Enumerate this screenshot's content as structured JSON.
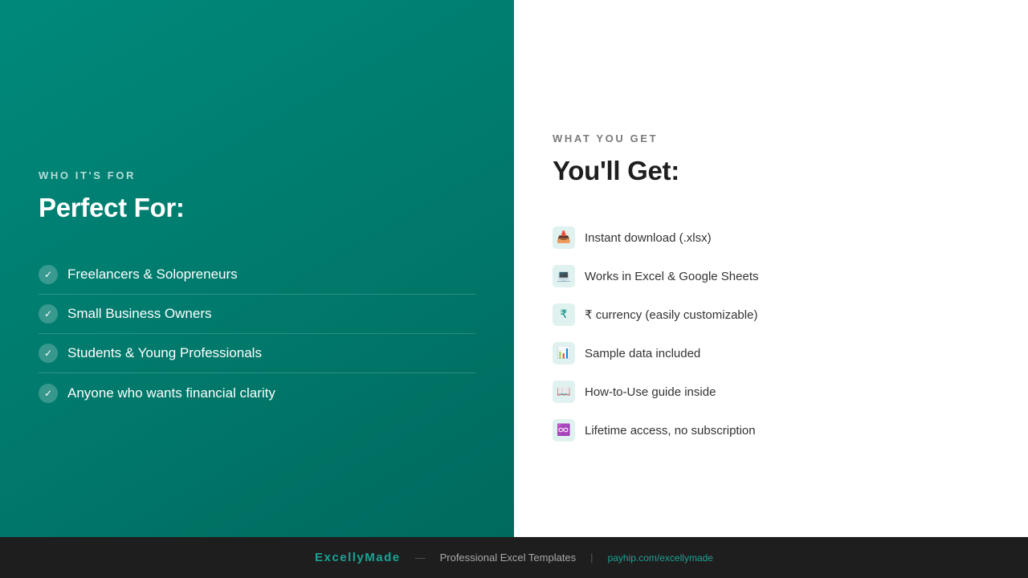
{
  "left_panel": {
    "eyebrow": "WHO IT'S FOR",
    "title": "Perfect For:",
    "check_glyph": "✓",
    "items": [
      "Freelancers & Solopreneurs",
      "Small Business Owners",
      "Students & Young Professionals",
      "Anyone who wants financial clarity"
    ]
  },
  "right_panel": {
    "eyebrow": "WHAT YOU GET",
    "title": "You'll Get:",
    "items": [
      {
        "icon": "📥",
        "icon_name": "inbox-tray-icon",
        "label": "Instant download (.xlsx)"
      },
      {
        "icon": "💻",
        "icon_name": "laptop-icon",
        "label": "Works in Excel & Google Sheets"
      },
      {
        "icon": "₹",
        "icon_name": "rupee-icon",
        "label": "₹ currency (easily customizable)"
      },
      {
        "icon": "📊",
        "icon_name": "bar-chart-icon",
        "label": "Sample data included"
      },
      {
        "icon": "📖",
        "icon_name": "open-book-icon",
        "label": "How-to-Use guide inside"
      },
      {
        "icon": "♾️",
        "icon_name": "infinity-icon",
        "label": "Lifetime access, no subscription"
      }
    ]
  },
  "footer": {
    "brand": "ExcellyMade",
    "separator": "—",
    "tagline": "Professional Excel Templates",
    "divider": "|",
    "link": "payhip.com/excellymade"
  },
  "colors": {
    "teal_primary": "#00897b",
    "teal_dark": "#006a5e",
    "footer_bg": "#1e1e1e",
    "accent_text": "#1aa394"
  }
}
